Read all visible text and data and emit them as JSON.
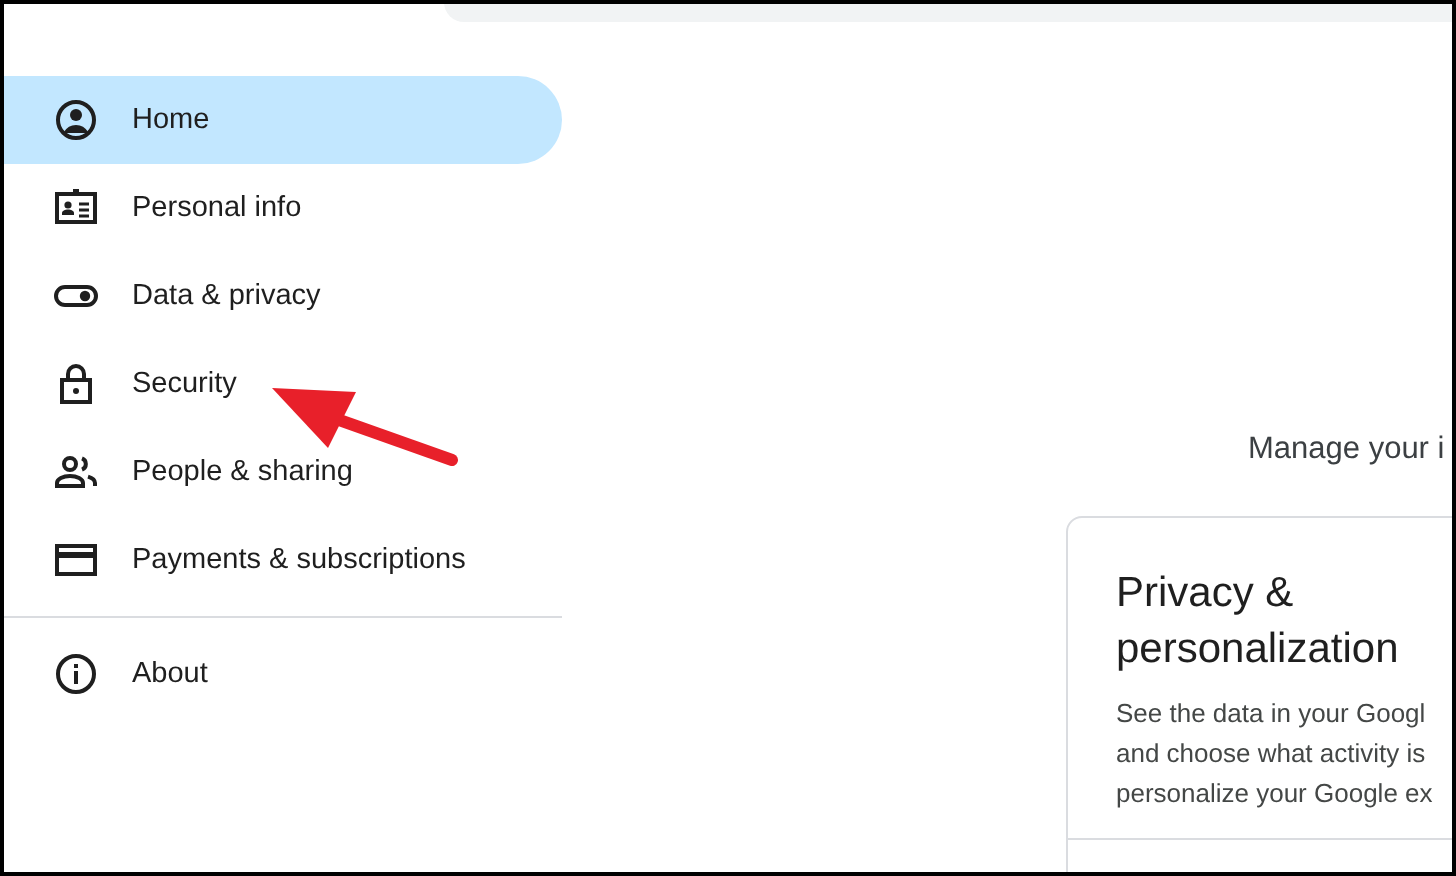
{
  "sidebar": {
    "items": [
      {
        "label": "Home",
        "kind": "account",
        "selected": true
      },
      {
        "label": "Personal info",
        "kind": "id-card",
        "selected": false
      },
      {
        "label": "Data & privacy",
        "kind": "toggle",
        "selected": false
      },
      {
        "label": "Security",
        "kind": "lock",
        "selected": false
      },
      {
        "label": "People & sharing",
        "kind": "people",
        "selected": false
      },
      {
        "label": "Payments & subscriptions",
        "kind": "card",
        "selected": false
      }
    ],
    "footer_items": [
      {
        "label": "About",
        "kind": "info",
        "selected": false
      }
    ]
  },
  "main": {
    "subtitle": "Manage your i",
    "card": {
      "title": "Privacy & personalization",
      "lines": [
        "See the data in your Googl",
        "and choose what activity is",
        "personalize your Google ex"
      ]
    }
  }
}
